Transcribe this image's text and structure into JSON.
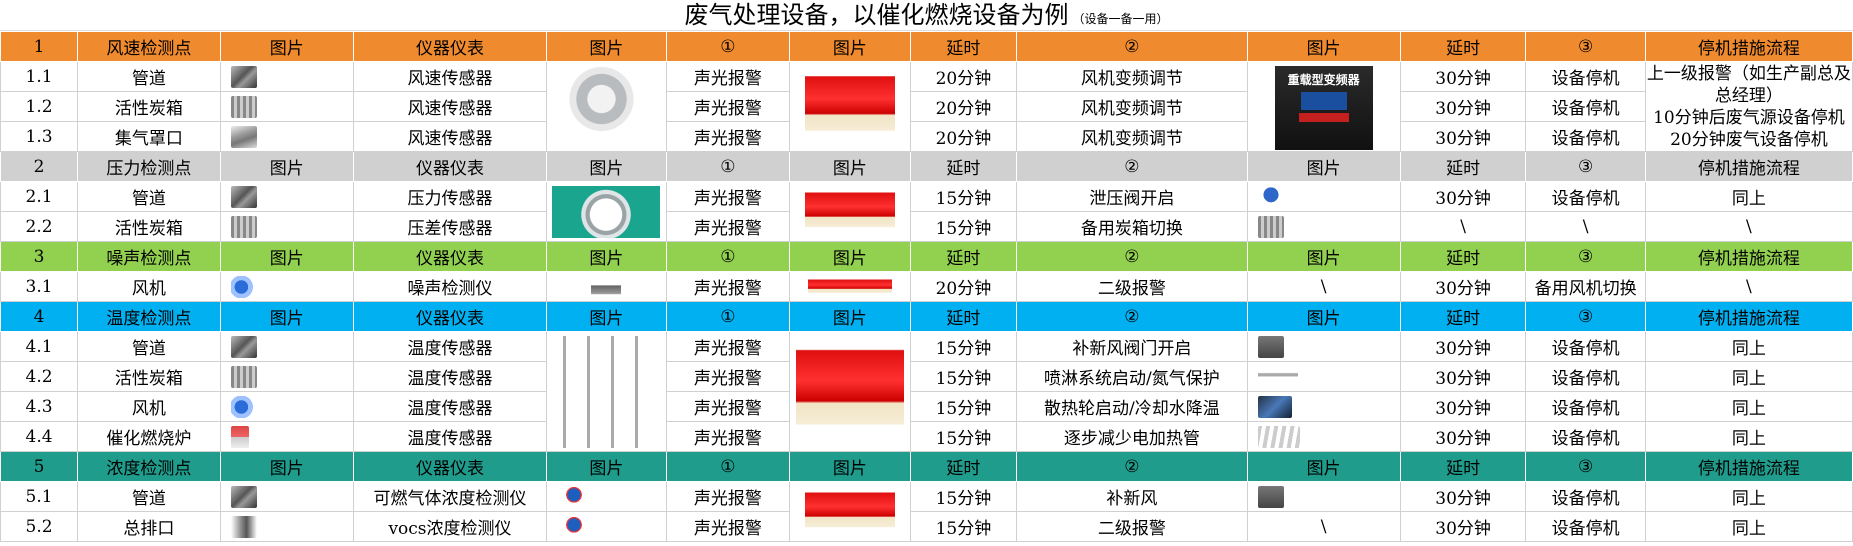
{
  "title": "废气处理设备，以催化燃烧设备为例",
  "subtitle": "（设备一备一用）",
  "colors": {
    "section1": "#f08a2e",
    "section2": "#d0d0d0",
    "section3": "#92d050",
    "section4": "#00b0f0",
    "section5": "#1f9c8c"
  },
  "sections": [
    {
      "header": {
        "no": "1",
        "point": "风速检测点",
        "pic": "图片",
        "instrument": "仪器仪表",
        "pic2": "图片",
        "step1": "①",
        "pic3": "图片",
        "delay": "延时",
        "step2": "②",
        "pic4": "图片",
        "delay2": "延时",
        "step3": "③",
        "shutdown": "停机措施流程"
      },
      "rows": [
        {
          "no": "1.1",
          "point": "管道",
          "instrument": "风速传感器",
          "step1": "声光报警",
          "delay": "20分钟",
          "step2": "风机变频调节",
          "delay2": "30分钟",
          "step3": "设备停机"
        },
        {
          "no": "1.2",
          "point": "活性炭箱",
          "instrument": "风速传感器",
          "step1": "声光报警",
          "delay": "20分钟",
          "step2": "风机变频调节",
          "delay2": "30分钟",
          "step3": "设备停机"
        },
        {
          "no": "1.3",
          "point": "集气罩口",
          "instrument": "风速传感器",
          "step1": "声光报警",
          "delay": "20分钟",
          "step2": "风机变频调节",
          "delay2": "30分钟",
          "step3": "设备停机"
        }
      ],
      "shutdown_lines": [
        "上一级报警（如生产副总及总经理）",
        "10分钟后废气源设备停机",
        "20分钟废气设备停机"
      ],
      "vfd_label": "重载型变频器"
    },
    {
      "header": {
        "no": "2",
        "point": "压力检测点",
        "pic": "图片",
        "instrument": "仪器仪表",
        "pic2": "图片",
        "step1": "①",
        "pic3": "图片",
        "delay": "延时",
        "step2": "②",
        "pic4": "图片",
        "delay2": "延时",
        "step3": "③",
        "shutdown": "停机措施流程"
      },
      "rows": [
        {
          "no": "2.1",
          "point": "管道",
          "instrument": "压力传感器",
          "step1": "声光报警",
          "delay": "15分钟",
          "step2": "泄压阀开启",
          "delay2": "30分钟",
          "step3": "设备停机",
          "shutdown": "同上"
        },
        {
          "no": "2.2",
          "point": "活性炭箱",
          "instrument": "压差传感器",
          "step1": "声光报警",
          "delay": "15分钟",
          "step2": "备用炭箱切换",
          "delay2": "\\",
          "step3": "\\",
          "shutdown": "\\"
        }
      ]
    },
    {
      "header": {
        "no": "3",
        "point": "噪声检测点",
        "pic": "图片",
        "instrument": "仪器仪表",
        "pic2": "图片",
        "step1": "①",
        "pic3": "图片",
        "delay": "延时",
        "step2": "②",
        "pic4": "图片",
        "delay2": "延时",
        "step3": "③",
        "shutdown": "停机措施流程"
      },
      "rows": [
        {
          "no": "3.1",
          "point": "风机",
          "instrument": "噪声检测仪",
          "step1": "声光报警",
          "delay": "20分钟",
          "step2": "二级报警",
          "pic4": "\\",
          "delay2": "30分钟",
          "step3": "备用风机切换",
          "shutdown": "\\"
        }
      ]
    },
    {
      "header": {
        "no": "4",
        "point": "温度检测点",
        "pic": "图片",
        "instrument": "仪器仪表",
        "pic2": "图片",
        "step1": "①",
        "pic3": "图片",
        "delay": "延时",
        "step2": "②",
        "pic4": "图片",
        "delay2": "延时",
        "step3": "③",
        "shutdown": "停机措施流程"
      },
      "rows": [
        {
          "no": "4.1",
          "point": "管道",
          "instrument": "温度传感器",
          "step1": "声光报警",
          "delay": "15分钟",
          "step2": "补新风阀门开启",
          "delay2": "30分钟",
          "step3": "设备停机",
          "shutdown": "同上"
        },
        {
          "no": "4.2",
          "point": "活性炭箱",
          "instrument": "温度传感器",
          "step1": "声光报警",
          "delay": "15分钟",
          "step2": "喷淋系统启动/氮气保护",
          "delay2": "30分钟",
          "step3": "设备停机",
          "shutdown": "同上"
        },
        {
          "no": "4.3",
          "point": "风机",
          "instrument": "温度传感器",
          "step1": "声光报警",
          "delay": "15分钟",
          "step2": "散热轮启动/冷却水降温",
          "delay2": "30分钟",
          "step3": "设备停机",
          "shutdown": "同上"
        },
        {
          "no": "4.4",
          "point": "催化燃烧炉",
          "instrument": "温度传感器",
          "step1": "声光报警",
          "delay": "15分钟",
          "step2": "逐步减少电加热管",
          "delay2": "30分钟",
          "step3": "设备停机",
          "shutdown": "同上"
        }
      ]
    },
    {
      "header": {
        "no": "5",
        "point": "浓度检测点",
        "pic": "图片",
        "instrument": "仪器仪表",
        "pic2": "图片",
        "step1": "①",
        "pic3": "图片",
        "delay": "延时",
        "step2": "②",
        "pic4": "图片",
        "delay2": "延时",
        "step3": "③",
        "shutdown": "停机措施流程"
      },
      "rows": [
        {
          "no": "5.1",
          "point": "管道",
          "instrument": "可燃气体浓度检测仪",
          "step1": "声光报警",
          "delay": "15分钟",
          "step2": "补新风",
          "delay2": "30分钟",
          "step3": "设备停机",
          "shutdown": "同上"
        },
        {
          "no": "5.2",
          "point": "总排口",
          "instrument": "vocs浓度检测仪",
          "step1": "声光报警",
          "delay": "15分钟",
          "step2": "二级报警",
          "pic4": "\\",
          "delay2": "30分钟",
          "step3": "设备停机",
          "shutdown": "同上"
        }
      ]
    }
  ]
}
